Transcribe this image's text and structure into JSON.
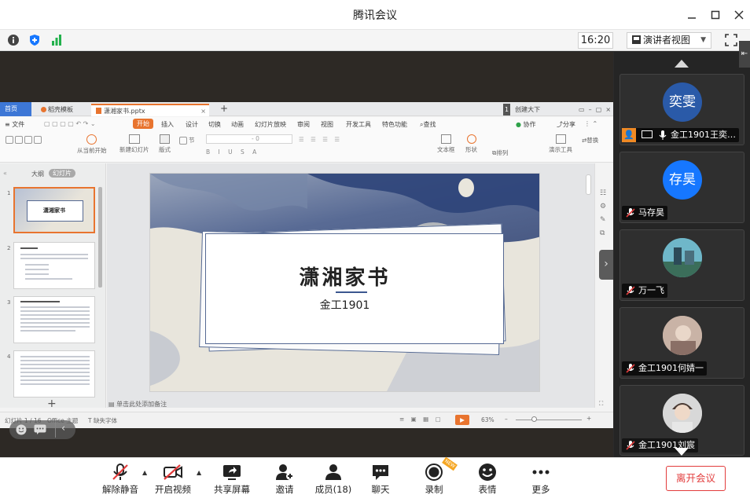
{
  "window": {
    "title": "腾讯会议"
  },
  "infobar": {
    "time": "16:20",
    "view_mode": "演讲者视图"
  },
  "wps": {
    "tabs": [
      "首页",
      "稻壳模板",
      "潇湘家书.pptx"
    ],
    "right_tab": "创建大下",
    "menu": [
      "文件",
      "开始",
      "插入",
      "设计",
      "切换",
      "动画",
      "幻灯片放映",
      "审阅",
      "视图",
      "开发工具",
      "特色功能",
      "查找"
    ],
    "menu_right": [
      "协作",
      "分享"
    ],
    "toolbar": [
      "从当前开始",
      "新建幻灯片",
      "版式",
      "节",
      "文本框",
      "形状",
      "排列",
      "演示工具",
      "替换"
    ],
    "panel_tabs": [
      "大纲",
      "幻灯片"
    ],
    "thumb_numbers": [
      "1",
      "2",
      "3",
      "4"
    ],
    "note_placeholder": "单击此处添加备注",
    "status_left": "幻灯片 1 / 16",
    "status_theme": "Office 主题",
    "status_font": "缺失字体",
    "zoom": "63%"
  },
  "slide": {
    "title": "潇湘家书",
    "subtitle": "金工1901"
  },
  "participants": [
    {
      "name": "金工1901王奕…",
      "avatar_text": "奕雯",
      "avatar_color": "#2a5aa8"
    },
    {
      "name": "马存昊",
      "avatar_text": "存昊",
      "avatar_color": "#1677ff"
    },
    {
      "name": "万一飞",
      "avatar_text": "",
      "avatar_color": "#4a8fa3"
    },
    {
      "name": "金工1901何婧一",
      "avatar_text": "",
      "avatar_color": "#b89a8c"
    },
    {
      "name": "金工1901刘宸",
      "avatar_text": "",
      "avatar_color": "#a7a7a7"
    }
  ],
  "bottombar": {
    "unmute": "解除静音",
    "video": "开启视频",
    "share": "共享屏幕",
    "invite": "邀请",
    "members": "成员(18)",
    "chat": "聊天",
    "record": "录制",
    "record_badge": "NEW",
    "reactions": "表情",
    "more": "更多",
    "leave": "离开会议"
  }
}
